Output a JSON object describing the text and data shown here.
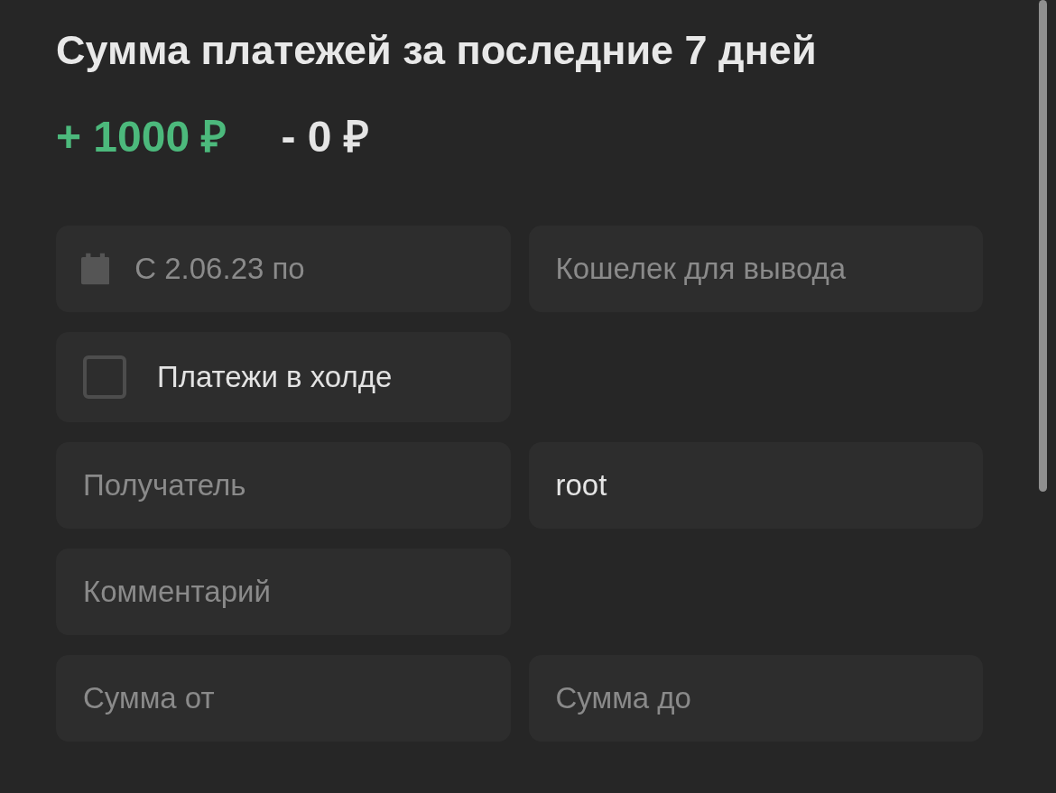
{
  "title": "Сумма платежей за последние 7 дней",
  "totals": {
    "income": "+ 1000 ₽",
    "expense": "- 0 ₽"
  },
  "filter_rows": [
    [
      {
        "kind": "date",
        "placeholder": "С 2.06.23 по"
      },
      {
        "kind": "text",
        "placeholder": "Кошелек для вывода"
      }
    ],
    [
      {
        "kind": "checkbox",
        "label": "Платежи в холде",
        "checked": false
      }
    ],
    [
      {
        "kind": "text",
        "placeholder": "Получатель"
      },
      {
        "kind": "text",
        "value": "root"
      }
    ],
    [
      {
        "kind": "text",
        "placeholder": "Комментарий"
      }
    ],
    [
      {
        "kind": "text",
        "placeholder": "Сумма от"
      },
      {
        "kind": "text",
        "placeholder": "Сумма до"
      }
    ]
  ]
}
